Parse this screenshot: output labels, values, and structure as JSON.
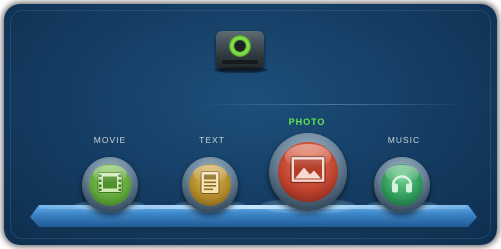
{
  "menu": {
    "items": [
      {
        "label": "MOVIE",
        "icon": "film-icon",
        "color": "#5fa83a",
        "active": false
      },
      {
        "label": "TEXT",
        "icon": "document-icon",
        "color": "#b38a2a",
        "active": false
      },
      {
        "label": "PHOTO",
        "icon": "picture-icon",
        "color": "#c0442f",
        "active": true
      },
      {
        "label": "MUSIC",
        "icon": "headphones-icon",
        "color": "#2f9a5a",
        "active": false
      }
    ]
  },
  "device": {
    "icon": "storage-drive-icon"
  },
  "colors": {
    "background": "#143c62",
    "active_label": "#62e84c",
    "label": "#c9d3da"
  }
}
